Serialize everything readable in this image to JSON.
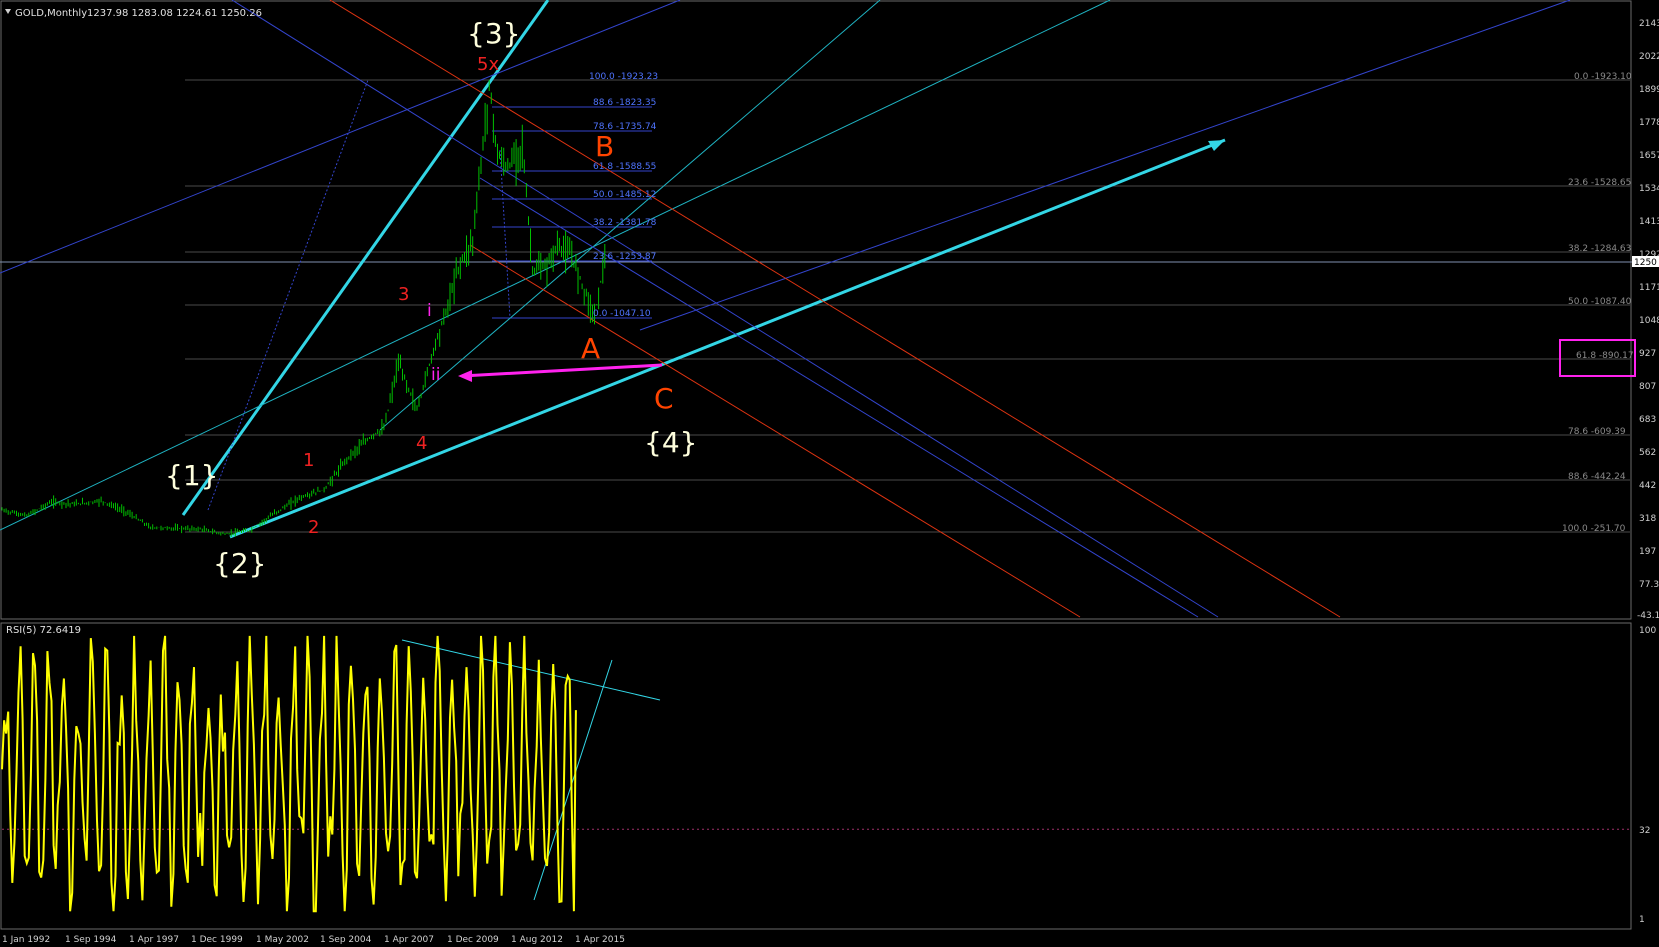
{
  "header": {
    "symbol_period": "GOLD,Monthly",
    "ohlc": "1237.98 1283.08 1224.61 1250.26"
  },
  "price_axis": {
    "ticks": [
      "2143",
      "2022",
      "1899",
      "1778",
      "1657",
      "1534",
      "1413",
      "1292",
      "1171",
      "1048",
      "927",
      "807",
      "683",
      "562",
      "442",
      "318",
      "197",
      "77.3",
      "-43.1"
    ],
    "current_price_label": "1250"
  },
  "time_axis": {
    "labels": [
      "1 Jan 1992",
      "1 Sep 1994",
      "1 Apr 1997",
      "1 Dec 1999",
      "1 May 2002",
      "1 Sep 2004",
      "1 Apr 2007",
      "1 Dec 2009",
      "1 Aug 2012",
      "1 Apr 2015"
    ]
  },
  "fib_retracement_inner": [
    {
      "label": "100.0 -1923.23"
    },
    {
      "label": "88.6 -1823.35"
    },
    {
      "label": "78.6 -1735.74"
    },
    {
      "label": "61.8 -1588.55"
    },
    {
      "label": "50.0 -1485.12"
    },
    {
      "label": "38.2 -1381.78"
    },
    {
      "label": "23.6 -1253.87"
    },
    {
      "label": "0.0 -1047.10"
    }
  ],
  "fib_retracement_outer": [
    {
      "label": "0.0 -1923.10"
    },
    {
      "label": "23.6 -1528.65"
    },
    {
      "label": "38.2 -1284.63"
    },
    {
      "label": "50.0 -1087.40"
    },
    {
      "label": "61.8 -890.17"
    },
    {
      "label": "78.6 -609.39"
    },
    {
      "label": "88.6 -442.24"
    },
    {
      "label": "100.0 -251.70"
    }
  ],
  "wave_labels": {
    "w1": "{1}",
    "w2": "{2}",
    "w3": "{3}",
    "w4": "{4}",
    "A": "A",
    "B": "B",
    "C": "C",
    "sub1": "1",
    "sub2": "2",
    "sub3": "3",
    "sub4": "4",
    "sub5": "5x",
    "roman_i": "i",
    "roman_ii": "ii"
  },
  "rsi_panel": {
    "title": "RSI(5) 72.6419",
    "axis_top": "100",
    "axis_level": "32",
    "axis_bottom": "1"
  },
  "colors": {
    "background": "#000000",
    "price_bars": "#00c000",
    "rsi_line": "#ffff00",
    "trendline_cyan": "#33d6e6",
    "channel_blue": "#3344cc",
    "channel_red": "#dd3311",
    "fib_level": "#444444",
    "fib_text": "#3366ff",
    "wave_white": "#ffffdd",
    "wave_orange": "#ff4400",
    "wave_red": "#ee2222",
    "magenta": "#ff22ee"
  },
  "chart_data": {
    "type": "line",
    "title": "GOLD,Monthly",
    "x": [
      "1992-01",
      "1993-01",
      "1994-01",
      "1995-01",
      "1996-01",
      "1997-01",
      "1998-01",
      "1999-01",
      "2000-01",
      "2001-01",
      "2002-01",
      "2003-01",
      "2004-01",
      "2005-01",
      "2006-01",
      "2007-01",
      "2007-06",
      "2008-01",
      "2008-10",
      "2009-06",
      "2010-01",
      "2010-06",
      "2011-01",
      "2011-09",
      "2012-01",
      "2012-06",
      "2013-01",
      "2013-06",
      "2014-01",
      "2014-06",
      "2015-01",
      "2015-12",
      "2016-06"
    ],
    "series": [
      {
        "name": "GOLD,Monthly",
        "values": [
          354,
          333,
          383,
          375,
          388,
          348,
          290,
          287,
          284,
          266,
          279,
          342,
          398,
          428,
          550,
          630,
          650,
          890,
          720,
          940,
          1100,
          1240,
          1340,
          1900,
          1650,
          1600,
          1690,
          1230,
          1240,
          1320,
          1280,
          1060,
          1320
        ]
      }
    ],
    "ylim": [
      -43.1,
      2200
    ],
    "rsi": {
      "name": "RSI(5)",
      "last_value": 72.6419,
      "level": 32,
      "ylim": [
        1,
        100
      ]
    }
  }
}
